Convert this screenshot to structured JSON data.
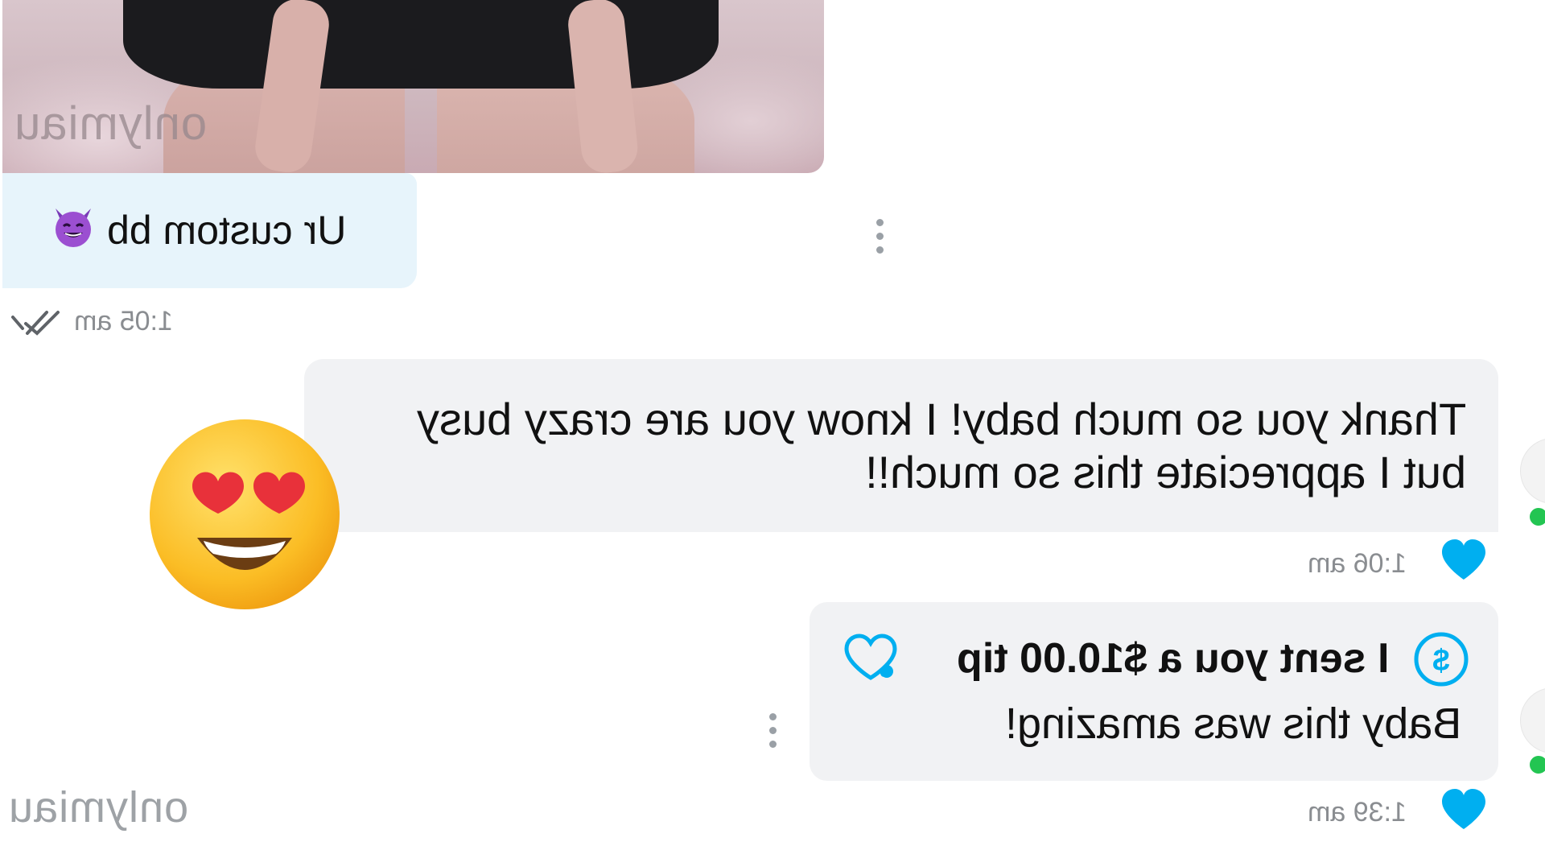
{
  "photo": {
    "watermark": "onlymiau",
    "icon": "photo-attachment"
  },
  "incoming": {
    "text": "Ur custom bb",
    "emoji": "😈",
    "time": "1:05 am",
    "status_icon": "double-check-icon"
  },
  "outgoing1": {
    "line1": "Thank you so much baby! I know you are crazy busy",
    "line2": "but I appreciate this so much!!",
    "side_emoji": "😍",
    "time": "1:06 am",
    "like_icon": "heart-icon"
  },
  "outgoing2": {
    "tip_text": "I sent you a $10.00 tip",
    "message": "Baby this was amazing!",
    "time": "1:39 am",
    "tip_icon": "dollar-icon",
    "like_icon": "heart-icon"
  },
  "watermark_bottom": "onlymiau",
  "colors": {
    "incoming_bubble": "#e7f4fb",
    "outgoing_bubble": "#f1f2f4",
    "accent_blue": "#00aff0",
    "timestamp": "#8a8d91",
    "online": "#23c552"
  }
}
